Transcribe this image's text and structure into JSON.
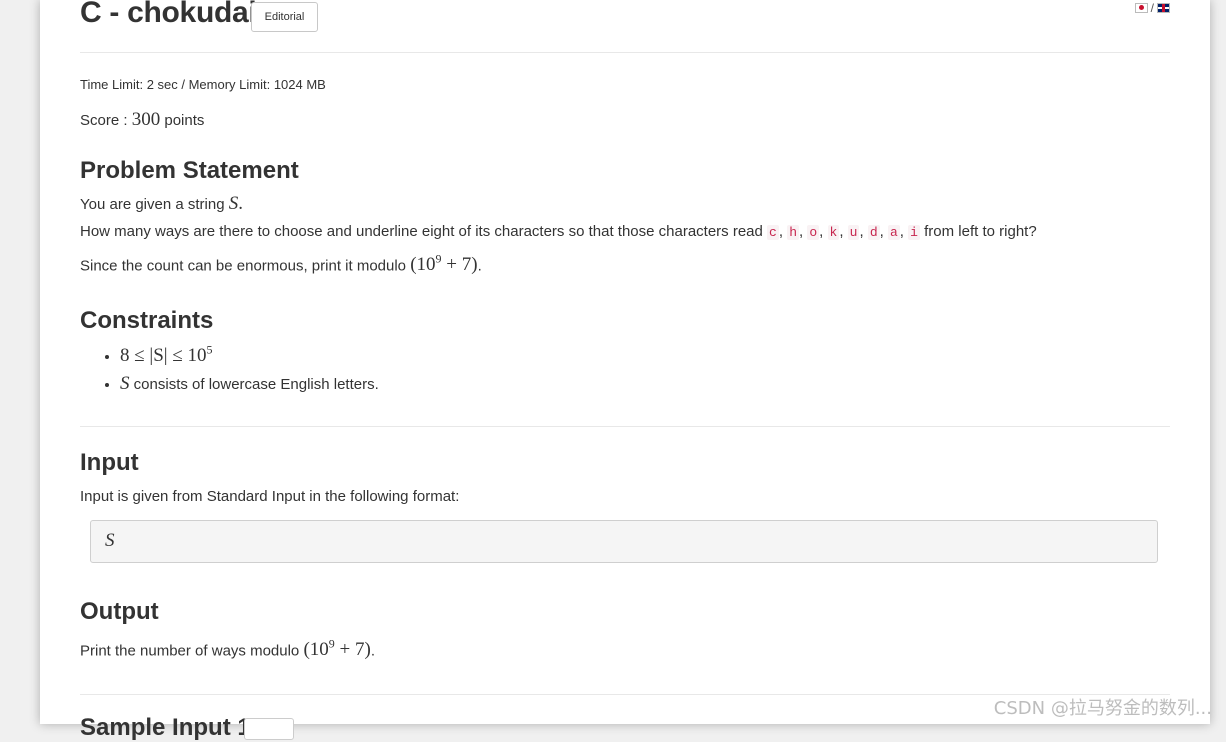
{
  "task": {
    "title": "C - chokudai",
    "editorial_label": "Editorial",
    "language_separator": "/",
    "limits": "Time Limit: 2 sec / Memory Limit: 1024 MB",
    "score_label": "Score :",
    "score_value": "300",
    "score_unit": "points"
  },
  "statement": {
    "heading": "Problem Statement",
    "line1_prefix": "You are given a string",
    "line1_var": "S",
    "line1_suffix": ".",
    "line2_prefix": "How many ways are there to choose and underline eight of its characters so that those characters read",
    "letters": [
      "c",
      "h",
      "o",
      "k",
      "u",
      "d",
      "a",
      "i"
    ],
    "line2_suffix": "from left to right?",
    "line3_prefix": "Since the count can be enormous, print it modulo",
    "mod_base": "(10",
    "mod_exp": "9",
    "mod_rest": " + 7)",
    "line3_suffix": "."
  },
  "constraints": {
    "heading": "Constraints",
    "c1_math": "8 ≤ |S| ≤ 10",
    "c1_exp": "5",
    "c2_var": "S",
    "c2_text": "consists of lowercase English letters."
  },
  "input": {
    "heading": "Input",
    "description": "Input is given from Standard Input in the following format:",
    "format_var": "S"
  },
  "output": {
    "heading": "Output",
    "description_prefix": "Print the number of ways modulo",
    "suffix": "."
  },
  "sample": {
    "heading_partial": "Sample Input 1"
  },
  "watermark": "CSDN @拉马努金的数列..."
}
